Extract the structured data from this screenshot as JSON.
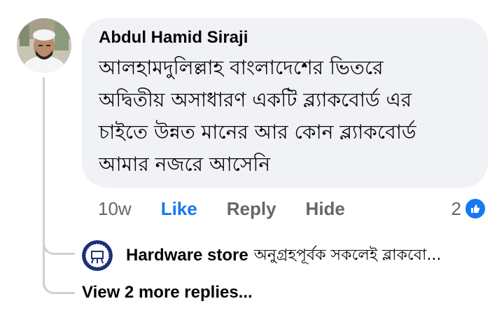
{
  "comment": {
    "author": "Abdul Hamid Siraji",
    "text": "আলহামদুলিল্লাহ বাংলাদেশের ভিতরে\nঅদ্বিতীয় অসাধারণ একটি ব্ল্যাকবোর্ড এর\nচাইতে উন্নত মানের আর কোন ব্ল্যাকবোর্ড\nআমার নজরে আসেনি",
    "time": "10w",
    "like_label": "Like",
    "reply_label": "Reply",
    "hide_label": "Hide",
    "reaction_count": "2"
  },
  "reply_preview": {
    "author": "Hardware store",
    "snippet": "অনুগ্রহপূর্বক সকলেই ব্লাকবো..."
  },
  "more_replies_label": "View 2 more replies...",
  "colors": {
    "accent": "#1877f2",
    "bubble_bg": "#f0f2f5",
    "secondary_text": "#65676b",
    "thread_line": "#ced0d4"
  }
}
